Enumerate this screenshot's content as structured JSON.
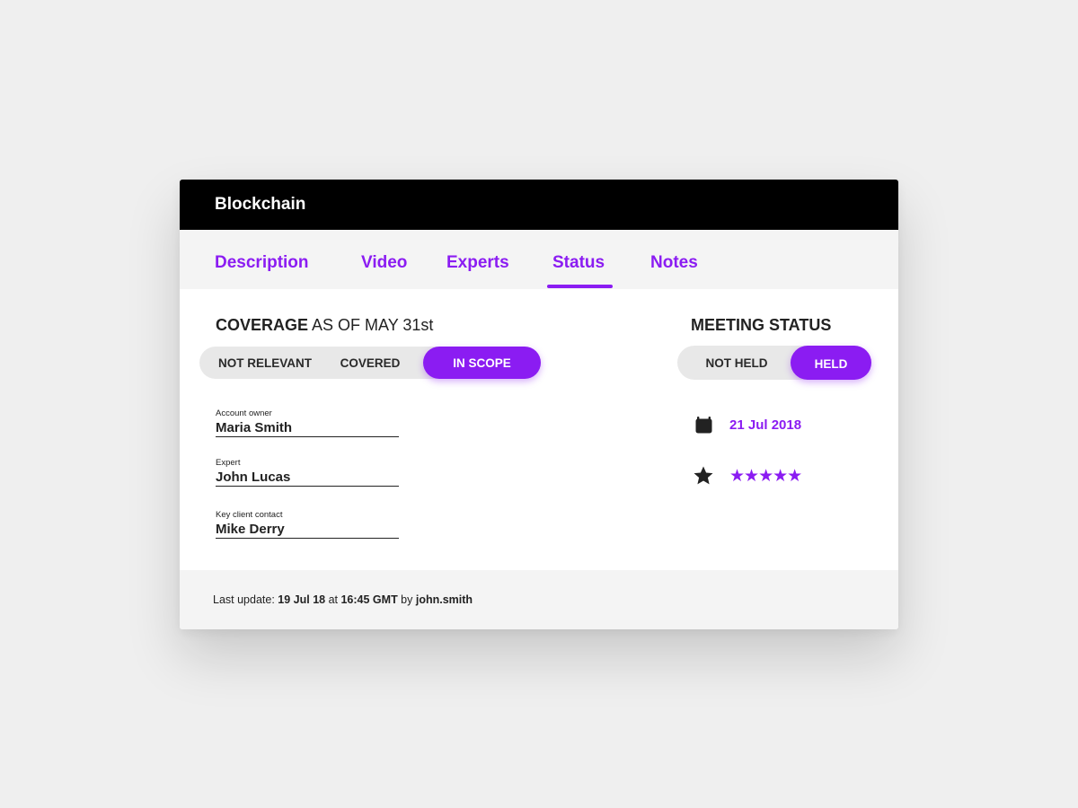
{
  "window": {
    "title": "Blockchain"
  },
  "tabs": [
    {
      "label": "Description"
    },
    {
      "label": "Video"
    },
    {
      "label": "Experts"
    },
    {
      "label": "Status"
    },
    {
      "label": "Notes"
    }
  ],
  "active_tab": "Status",
  "coverage": {
    "title_bold": "COVERAGE",
    "title_rest": " AS OF MAY 31st",
    "options": [
      "NOT RELEVANT",
      "COVERED",
      "IN SCOPE"
    ],
    "selected": "IN SCOPE"
  },
  "meeting_status": {
    "title": "MEETING STATUS",
    "options": [
      "NOT HELD",
      "HELD"
    ],
    "selected": "HELD",
    "date": "21 Jul 2018",
    "date_icon": "calendar-icon",
    "rating_icon": "star-icon",
    "rating": 5,
    "rating_max": 5,
    "rating_stars": "★★★★★"
  },
  "fields": [
    {
      "label": "Account owner",
      "value": "Maria Smith"
    },
    {
      "label": "Expert",
      "value": "John Lucas"
    },
    {
      "label": "Key client contact",
      "value": "Mike Derry"
    }
  ],
  "footer": {
    "prefix": "Last update: ",
    "date": "19 Jul 18",
    "at": " at ",
    "time": "16:45 GMT",
    "by": " by ",
    "user": "john.smith"
  },
  "colors": {
    "accent": "#8b1cf2",
    "titlebar": "#000000",
    "tabbar": "#f4f4f4",
    "toggle_bg": "#e8e8e8"
  }
}
